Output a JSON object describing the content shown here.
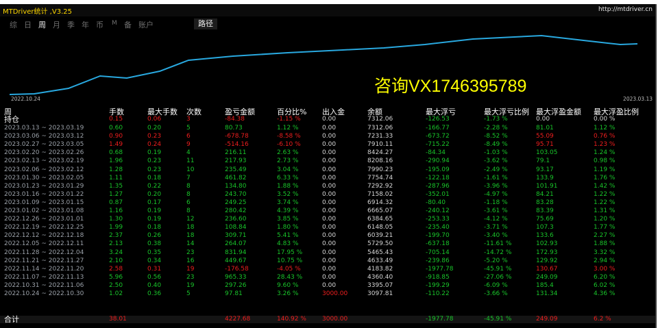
{
  "window": {
    "title": "MTDriver统计 ,V3.25",
    "url": "http://mtdriver.cn"
  },
  "tabs": [
    {
      "label": "综",
      "active": false
    },
    {
      "label": "日",
      "active": false
    },
    {
      "label": "周",
      "active": true
    },
    {
      "label": "月",
      "active": false
    },
    {
      "label": "季",
      "active": false
    },
    {
      "label": "年",
      "active": false
    },
    {
      "label": "币",
      "active": false
    },
    {
      "label": "M",
      "active": false
    },
    {
      "label": "备",
      "active": false
    },
    {
      "label": "账户",
      "active": false
    }
  ],
  "route_button": "路径",
  "chart": {
    "date_start": "2022.10.24",
    "date_end": "2023.03.13",
    "line_color": "#29a9e0",
    "watermark": "咨询VX1746395789"
  },
  "table": {
    "headers": {
      "period": "周",
      "lots": "手数",
      "max_lots": "最大手数",
      "count": "次数",
      "pl": "盈亏金额",
      "pct": "百分比%",
      "io": "出入金",
      "balance": "余额",
      "max_float_loss": "最大浮亏",
      "max_float_loss_pct": "最大浮亏比例",
      "max_float_profit": "最大浮盈金额",
      "max_float_profit_pct": "最大浮盈比例"
    },
    "holding": {
      "period": "持仓",
      "lots": "0.15",
      "max_lots": "0.06",
      "count": "3",
      "pl": "-84.38",
      "pct": "-1.15 %",
      "io": "0.00",
      "balance": "7312.06",
      "max_float_loss": "-126.53",
      "max_float_loss_pct": "-1.73 %",
      "max_float_profit": "0.00",
      "max_float_profit_pct": "0.00 %"
    },
    "rows": [
      {
        "period": "2023.03.13 ~ 2023.03.19",
        "lots": "0.60",
        "max_lots": "0.20",
        "count": "5",
        "pl": "80.73",
        "pct": "1.12 %",
        "io": "0.00",
        "balance": "7312.06",
        "max_float_loss": "-166.77",
        "max_float_loss_pct": "-2.28 %",
        "max_float_profit": "81.01",
        "max_float_profit_pct": "1.12 %"
      },
      {
        "period": "2023.03.06 ~ 2023.03.12",
        "lots": "0.90",
        "max_lots": "0.23",
        "count": "6",
        "pl": "-678.78",
        "pct": "-8.58 %",
        "io": "0.00",
        "balance": "7231.33",
        "max_float_loss": "-673.72",
        "max_float_loss_pct": "-8.52 %",
        "max_float_profit": "55.09",
        "max_float_profit_pct": "0.76 %"
      },
      {
        "period": "2023.02.27 ~ 2023.03.05",
        "lots": "1.49",
        "max_lots": "0.24",
        "count": "9",
        "pl": "-514.16",
        "pct": "-6.10 %",
        "io": "0.00",
        "balance": "7910.11",
        "max_float_loss": "-715.22",
        "max_float_loss_pct": "-8.49 %",
        "max_float_profit": "95.71",
        "max_float_profit_pct": "1.23 %"
      },
      {
        "period": "2023.02.20 ~ 2023.02.26",
        "lots": "0.68",
        "max_lots": "0.19",
        "count": "4",
        "pl": "216.11",
        "pct": "2.63 %",
        "io": "0.00",
        "balance": "8424.27",
        "max_float_loss": "-84.34",
        "max_float_loss_pct": "-1.03 %",
        "max_float_profit": "103.05",
        "max_float_profit_pct": "1.24 %"
      },
      {
        "period": "2023.02.13 ~ 2023.02.19",
        "lots": "1.96",
        "max_lots": "0.23",
        "count": "11",
        "pl": "217.93",
        "pct": "2.73 %",
        "io": "0.00",
        "balance": "8208.16",
        "max_float_loss": "-290.94",
        "max_float_loss_pct": "-3.62 %",
        "max_float_profit": "79.1",
        "max_float_profit_pct": "0.98 %"
      },
      {
        "period": "2023.02.06 ~ 2023.02.12",
        "lots": "1.28",
        "max_lots": "0.23",
        "count": "10",
        "pl": "235.49",
        "pct": "3.04 %",
        "io": "0.00",
        "balance": "7990.23",
        "max_float_loss": "-195.09",
        "max_float_loss_pct": "-2.49 %",
        "max_float_profit": "93.17",
        "max_float_profit_pct": "1.19 %"
      },
      {
        "period": "2023.01.30 ~ 2023.02.05",
        "lots": "1.11",
        "max_lots": "0.18",
        "count": "7",
        "pl": "461.82",
        "pct": "6.33 %",
        "io": "0.00",
        "balance": "7754.74",
        "max_float_loss": "-122.18",
        "max_float_loss_pct": "-1.61 %",
        "max_float_profit": "133.9",
        "max_float_profit_pct": "1.76 %"
      },
      {
        "period": "2023.01.23 ~ 2023.01.29",
        "lots": "1.35",
        "max_lots": "0.22",
        "count": "8",
        "pl": "134.80",
        "pct": "1.88 %",
        "io": "0.00",
        "balance": "7292.92",
        "max_float_loss": "-287.96",
        "max_float_loss_pct": "-3.96 %",
        "max_float_profit": "101.91",
        "max_float_profit_pct": "1.42 %"
      },
      {
        "period": "2023.01.16 ~ 2023.01.22",
        "lots": "1.27",
        "max_lots": "0.20",
        "count": "8",
        "pl": "243.70",
        "pct": "3.52 %",
        "io": "0.00",
        "balance": "7158.02",
        "max_float_loss": "-352.01",
        "max_float_loss_pct": "-4.97 %",
        "max_float_profit": "84.21",
        "max_float_profit_pct": "1.22 %"
      },
      {
        "period": "2023.01.09 ~ 2023.01.15",
        "lots": "0.87",
        "max_lots": "0.17",
        "count": "6",
        "pl": "249.25",
        "pct": "3.74 %",
        "io": "0.00",
        "balance": "6914.32",
        "max_float_loss": "-80.40",
        "max_float_loss_pct": "-1.18 %",
        "max_float_profit": "83.28",
        "max_float_profit_pct": "1.22 %"
      },
      {
        "period": "2023.01.02 ~ 2023.01.08",
        "lots": "1.16",
        "max_lots": "0.19",
        "count": "8",
        "pl": "280.42",
        "pct": "4.39 %",
        "io": "0.00",
        "balance": "6665.07",
        "max_float_loss": "-240.12",
        "max_float_loss_pct": "-3.61 %",
        "max_float_profit": "83.39",
        "max_float_profit_pct": "1.31 %"
      },
      {
        "period": "2022.12.26 ~ 2023.01.01",
        "lots": "1.30",
        "max_lots": "0.19",
        "count": "12",
        "pl": "236.60",
        "pct": "3.85 %",
        "io": "0.00",
        "balance": "6384.65",
        "max_float_loss": "-253.33",
        "max_float_loss_pct": "-4.12 %",
        "max_float_profit": "75.69",
        "max_float_profit_pct": "1.20 %"
      },
      {
        "period": "2022.12.19 ~ 2022.12.25",
        "lots": "1.99",
        "max_lots": "0.18",
        "count": "18",
        "pl": "108.84",
        "pct": "1.80 %",
        "io": "0.00",
        "balance": "6148.05",
        "max_float_loss": "-235.40",
        "max_float_loss_pct": "-3.71 %",
        "max_float_profit": "107.3",
        "max_float_profit_pct": "1.77 %"
      },
      {
        "period": "2022.12.12 ~ 2022.12.18",
        "lots": "2.37",
        "max_lots": "0.26",
        "count": "18",
        "pl": "309.71",
        "pct": "5.41 %",
        "io": "0.00",
        "balance": "6039.21",
        "max_float_loss": "-199.70",
        "max_float_loss_pct": "-3.40 %",
        "max_float_profit": "133.6",
        "max_float_profit_pct": "2.27 %"
      },
      {
        "period": "2022.12.05 ~ 2022.12.11",
        "lots": "2.13",
        "max_lots": "0.38",
        "count": "14",
        "pl": "264.07",
        "pct": "4.83 %",
        "io": "0.00",
        "balance": "5729.50",
        "max_float_loss": "-637.18",
        "max_float_loss_pct": "-11.61 %",
        "max_float_profit": "102.93",
        "max_float_profit_pct": "1.88 %"
      },
      {
        "period": "2022.11.28 ~ 2022.12.04",
        "lots": "3.24",
        "max_lots": "0.35",
        "count": "23",
        "pl": "831.94",
        "pct": "17.95 %",
        "io": "0.00",
        "balance": "5465.43",
        "max_float_loss": "-705.14",
        "max_float_loss_pct": "-14.72 %",
        "max_float_profit": "172.93",
        "max_float_profit_pct": "3.32 %"
      },
      {
        "period": "2022.11.21 ~ 2022.11.27",
        "lots": "2.10",
        "max_lots": "0.34",
        "count": "16",
        "pl": "449.67",
        "pct": "10.75 %",
        "io": "0.00",
        "balance": "4633.49",
        "max_float_loss": "-239.86",
        "max_float_loss_pct": "-5.20 %",
        "max_float_profit": "129.92",
        "max_float_profit_pct": "2.94 %"
      },
      {
        "period": "2022.11.14 ~ 2022.11.20",
        "lots": "2.58",
        "max_lots": "0.31",
        "count": "19",
        "pl": "-176.58",
        "pct": "-4.05 %",
        "io": "0.00",
        "balance": "4183.82",
        "max_float_loss": "-1977.78",
        "max_float_loss_pct": "-45.91 %",
        "max_float_profit": "130.67",
        "max_float_profit_pct": "3.00 %"
      },
      {
        "period": "2022.11.07 ~ 2022.11.13",
        "lots": "5.96",
        "max_lots": "0.56",
        "count": "23",
        "pl": "965.33",
        "pct": "28.43 %",
        "io": "0.00",
        "balance": "4360.40",
        "max_float_loss": "-918.85",
        "max_float_loss_pct": "-27.06 %",
        "max_float_profit": "249.09",
        "max_float_profit_pct": "6.20 %"
      },
      {
        "period": "2022.10.31 ~ 2022.11.06",
        "lots": "2.50",
        "max_lots": "0.40",
        "count": "19",
        "pl": "297.26",
        "pct": "9.60 %",
        "io": "0.00",
        "balance": "3395.07",
        "max_float_loss": "-199.29",
        "max_float_loss_pct": "-6.09 %",
        "max_float_profit": "185.4",
        "max_float_profit_pct": "6.02 %"
      },
      {
        "period": "2022.10.24 ~ 2022.10.30",
        "lots": "1.02",
        "max_lots": "0.36",
        "count": "5",
        "pl": "97.81",
        "pct": "3.26 %",
        "io": "3000.00",
        "balance": "3097.81",
        "max_float_loss": "-110.22",
        "max_float_loss_pct": "-3.66 %",
        "max_float_profit": "131.34",
        "max_float_profit_pct": "4.36 %"
      }
    ],
    "total": {
      "period": "合计",
      "lots": "38.01",
      "max_lots": "",
      "count": "",
      "pl": "4227.68",
      "pct": "140.92 %",
      "io": "3000.00",
      "balance": "",
      "max_float_loss": "-1977.78",
      "max_float_loss_pct": "-45.91 %",
      "max_float_profit": "249.09",
      "max_float_profit_pct": "6.2 %"
    }
  }
}
